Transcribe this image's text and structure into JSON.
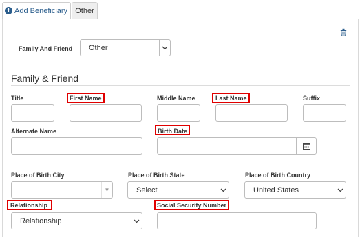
{
  "tabs": [
    {
      "label": "Add Beneficiary",
      "icon": "plus-circle-icon"
    },
    {
      "label": "Other"
    }
  ],
  "family_and_friend": {
    "label": "Family And Friend",
    "selected": "Other"
  },
  "section": {
    "title": "Family & Friend"
  },
  "fields": {
    "title": {
      "label": "Title",
      "value": ""
    },
    "first_name": {
      "label": "First Name",
      "value": ""
    },
    "middle_name": {
      "label": "Middle Name",
      "value": ""
    },
    "last_name": {
      "label": "Last Name",
      "value": ""
    },
    "suffix": {
      "label": "Suffix",
      "value": ""
    },
    "alternate_name": {
      "label": "Alternate Name",
      "value": ""
    },
    "birth_date": {
      "label": "Birth Date",
      "value": ""
    },
    "place_of_birth_city": {
      "label": "Place of Birth City",
      "value": ""
    },
    "place_of_birth_state": {
      "label": "Place of Birth State",
      "value": "Select"
    },
    "place_of_birth_country": {
      "label": "Place of Birth Country",
      "value": "United States"
    },
    "relationship": {
      "label": "Relationship",
      "value": "Relationship"
    },
    "ssn": {
      "label": "Social Security Number",
      "value": ""
    }
  },
  "colors": {
    "accent": "#2a5d8c",
    "highlight": "#e00000"
  }
}
